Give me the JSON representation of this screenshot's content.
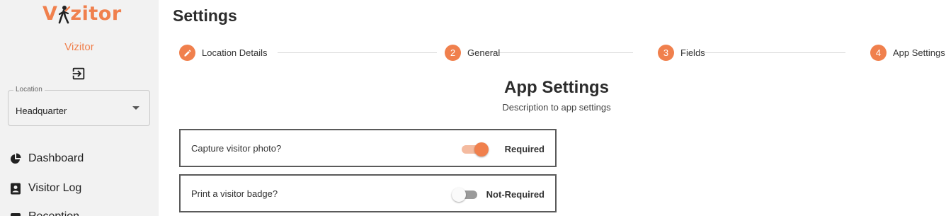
{
  "brand": {
    "logo_start": "V",
    "logo_end": "zitor",
    "org_name": "Vizitor",
    "accent_color": "#f0804d"
  },
  "sidebar": {
    "logout_icon": "logout-icon",
    "location": {
      "label": "Location",
      "value": "Headquarter"
    },
    "nav": [
      {
        "label": "Dashboard",
        "icon": "pie-chart-icon"
      },
      {
        "label": "Visitor Log",
        "icon": "contact-book-icon"
      },
      {
        "label": "Reception",
        "icon": "reception-icon"
      }
    ]
  },
  "main": {
    "title": "Settings",
    "steps": [
      {
        "marker": "",
        "icon": "pencil-icon",
        "label": "Location Details",
        "completed": true
      },
      {
        "marker": "2",
        "label": "General",
        "completed": false
      },
      {
        "marker": "3",
        "label": "Fields",
        "completed": false
      },
      {
        "marker": "4",
        "label": "App Settings",
        "completed": false
      }
    ],
    "section": {
      "title": "App Settings",
      "description": "Description to app settings"
    },
    "settings": [
      {
        "question": "Capture visitor photo?",
        "enabled": true,
        "status": "Required"
      },
      {
        "question": "Print a visitor badge?",
        "enabled": false,
        "status": "Not-Required"
      }
    ]
  }
}
